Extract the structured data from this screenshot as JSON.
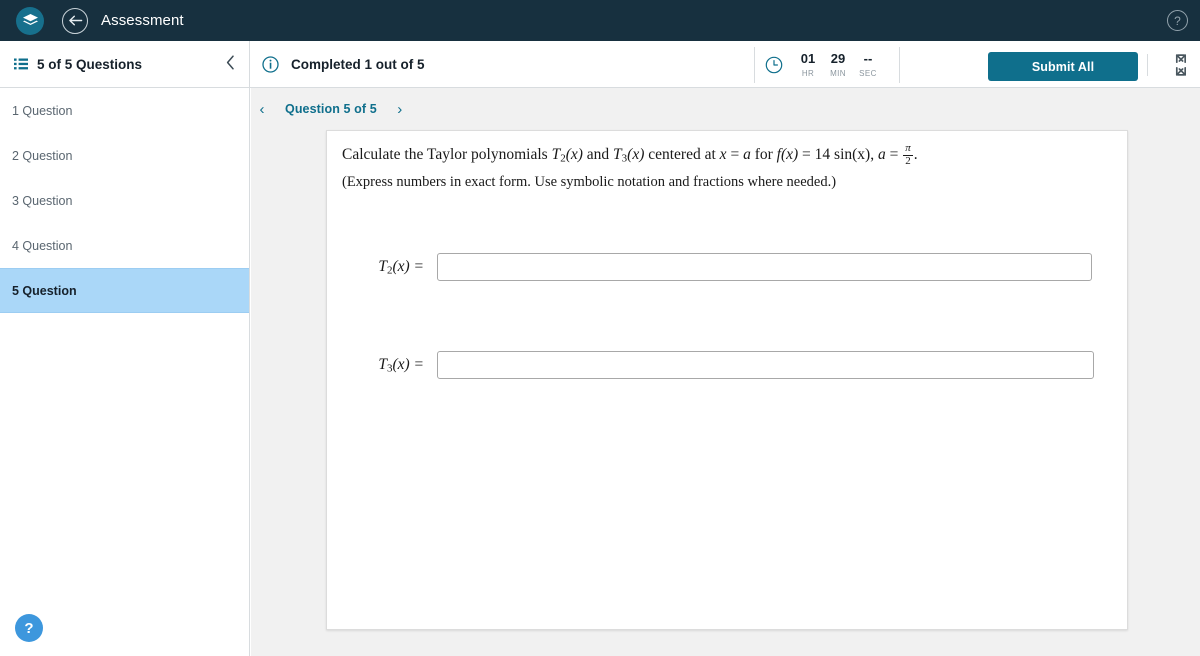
{
  "appbar": {
    "logo_icon": "layers-logo-icon",
    "back_icon": "back-arrow-icon",
    "title": "Assessment",
    "help_icon": "help-circle-icon",
    "background": "#17303f"
  },
  "subbar": {
    "list_icon": "list-icon",
    "question_count": "5 of 5 Questions",
    "collapse_icon": "chevron-left-icon",
    "info_icon": "info-circle-icon",
    "completed_text": "Completed 1 out of 5",
    "timer": {
      "clock_icon": "clock-icon",
      "units": [
        {
          "value": "01",
          "label": "HR"
        },
        {
          "value": "29",
          "label": "MIN"
        },
        {
          "value": "--",
          "label": "SEC"
        }
      ]
    },
    "submit_label": "Submit All",
    "submit_color": "#0f6f8c",
    "expand_icon": "fullscreen-expand-icon"
  },
  "sidebar": {
    "items": [
      {
        "label": "1 Question",
        "active": false
      },
      {
        "label": "2 Question",
        "active": false
      },
      {
        "label": "3 Question",
        "active": false
      },
      {
        "label": "4 Question",
        "active": false
      },
      {
        "label": "5 Question",
        "active": true
      }
    ],
    "active_color": "#aad7f8",
    "help_fab_label": "?",
    "help_fab_color": "#3d97dd"
  },
  "question_nav": {
    "prev_icon": "chevron-left-icon",
    "label": "Question 5 of 5",
    "next_icon": "chevron-right-icon",
    "accent": "#0f6f8c"
  },
  "question": {
    "prompt_parts": {
      "p1": "Calculate the Taylor polynomials ",
      "t2": "T",
      "t2_sub": "2",
      "t2_arg": "(x)",
      "and": " and ",
      "t3": "T",
      "t3_sub": "3",
      "t3_arg": "(x)",
      "p2": " centered at ",
      "x": "x",
      "eq1": " = ",
      "a1": "a",
      "p3": " for ",
      "f": "f",
      "f_arg": "(x)",
      "eq2": " = ",
      "coef": "14 sin(x)",
      "comma": ", ",
      "a2": "a",
      "eq3": " = ",
      "frac_num": "π",
      "frac_den": "2",
      "period": "."
    },
    "note": "(Express numbers in exact form. Use symbolic notation and fractions where needed.)",
    "answers": [
      {
        "label_base": "T",
        "label_sub": "2",
        "label_arg": "(x) =",
        "value": "",
        "placeholder": ""
      },
      {
        "label_base": "T",
        "label_sub": "3",
        "label_arg": "(x) =",
        "value": "",
        "placeholder": ""
      }
    ]
  }
}
